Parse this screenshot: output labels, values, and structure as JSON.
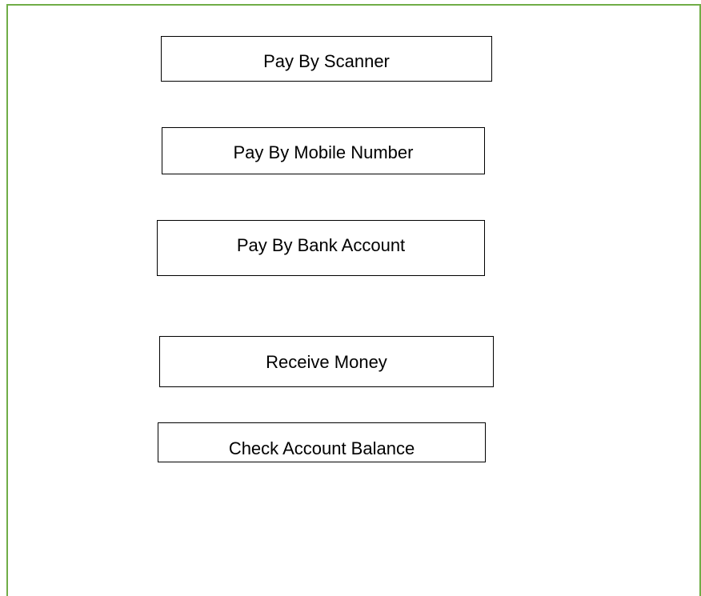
{
  "colors": {
    "frame_border": "#70ad47",
    "button_border": "#000000",
    "background": "#ffffff",
    "text": "#000000"
  },
  "menu": {
    "options": [
      {
        "label": "Pay By Scanner"
      },
      {
        "label": "Pay By Mobile Number"
      },
      {
        "label": "Pay By Bank Account"
      },
      {
        "label": "Receive Money"
      },
      {
        "label": "Check Account Balance"
      }
    ]
  }
}
